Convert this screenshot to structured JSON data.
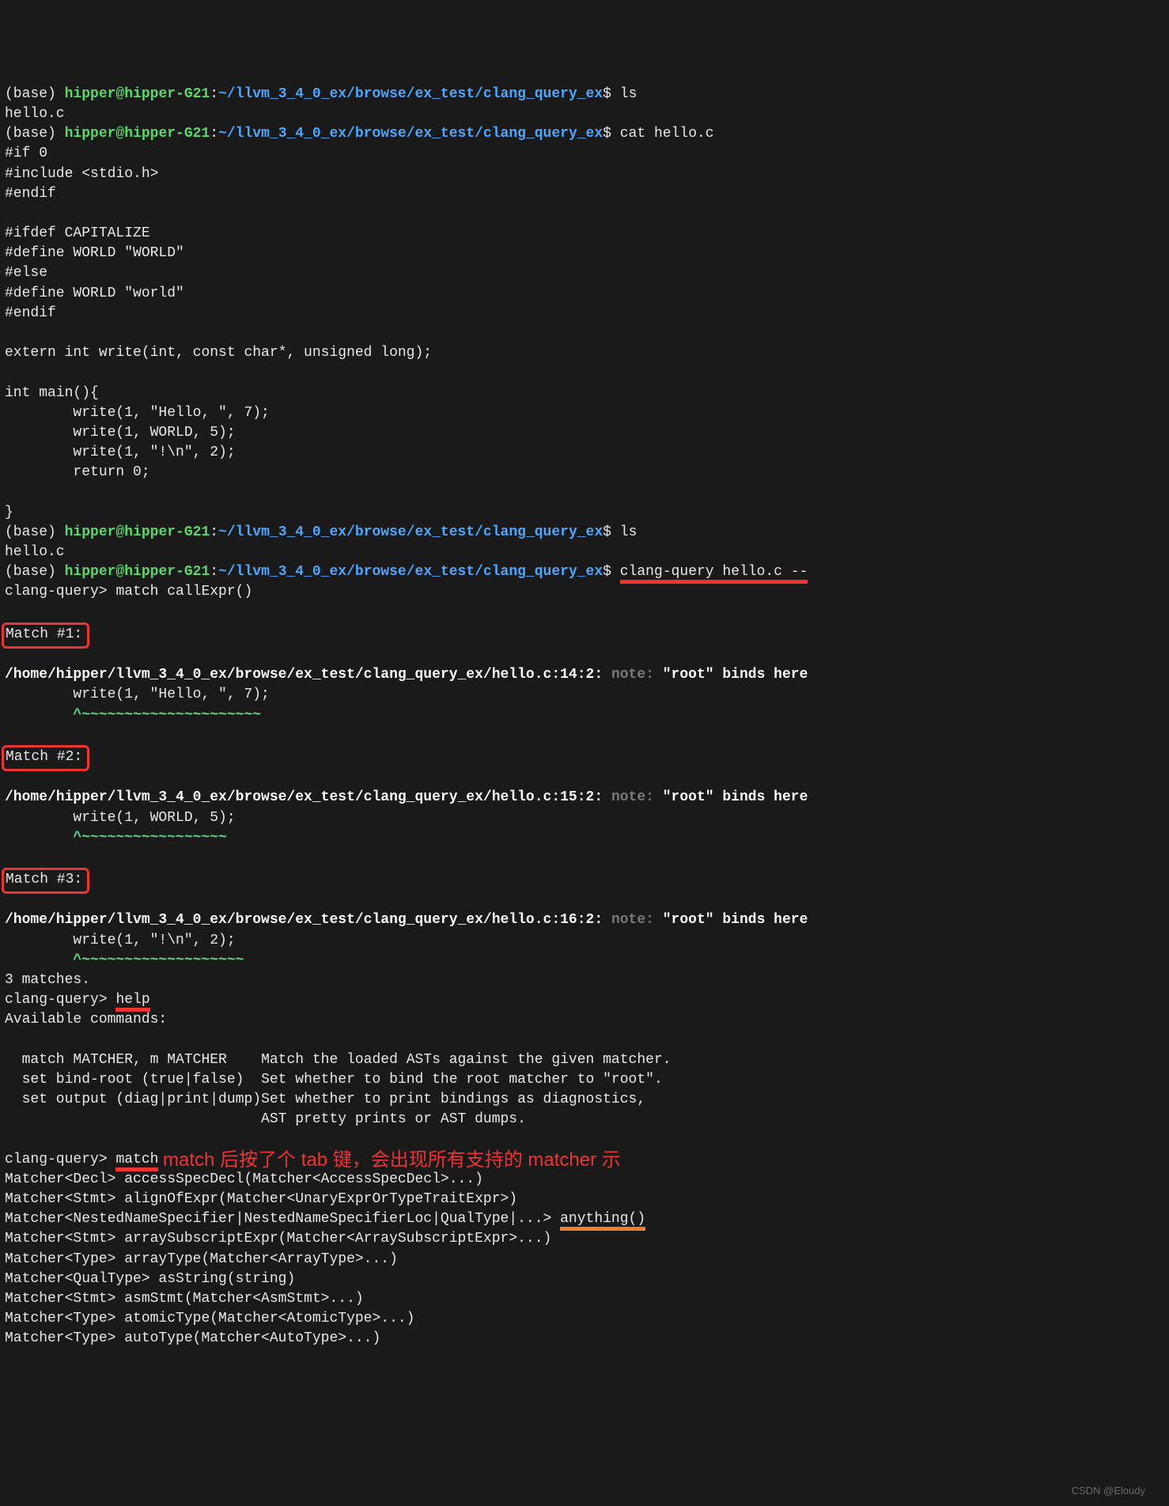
{
  "prompt": {
    "env": "(base) ",
    "userhost": "hipper@hipper-G21",
    "colon": ":",
    "cwd": "~/llvm_3_4_0_ex/browse/ex_test/clang_query_ex",
    "dollar": "$ "
  },
  "cmds": {
    "ls": "ls",
    "ls_out": "hello.c",
    "cat": "cat hello.c",
    "clang_query": "clang-query hello.c --",
    "cq_prompt": "clang-query> ",
    "match_call": "match callExpr()",
    "help": "help",
    "match": "match"
  },
  "src": {
    "l1": "#if 0",
    "l2": "#include <stdio.h>",
    "l3": "#endif",
    "l4": "",
    "l5": "#ifdef CAPITALIZE",
    "l6": "#define WORLD \"WORLD\"",
    "l7": "#else",
    "l8": "#define WORLD \"world\"",
    "l9": "#endif",
    "l10": "",
    "l11": "extern int write(int, const char*, unsigned long);",
    "l12": "",
    "l13": "int main(){",
    "l14": "        write(1, \"Hello, \", 7);",
    "l15": "        write(1, WORLD, 5);",
    "l16": "        write(1, \"!\\n\", 2);",
    "l17": "        return 0;",
    "l18": "",
    "l19": "}"
  },
  "match": {
    "m1": "Match #1:",
    "m2": "Match #2:",
    "m3": "Match #3:",
    "noteword": "note:",
    "note": " \"root\" binds here",
    "path1": "/home/hipper/llvm_3_4_0_ex/browse/ex_test/clang_query_ex/hello.c:14:2: ",
    "code1": "        write(1, \"Hello, \", 7);",
    "path2": "/home/hipper/llvm_3_4_0_ex/browse/ex_test/clang_query_ex/hello.c:15:2: ",
    "code2": "        write(1, WORLD, 5);",
    "path3": "/home/hipper/llvm_3_4_0_ex/browse/ex_test/clang_query_ex/hello.c:16:2: ",
    "code3": "        write(1, \"!\\n\", 2);",
    "tilde1": "        ^~~~~~~~~~~~~~~~~~~~~~",
    "tilde2": "        ^~~~~~~~~~~~~~~~~~",
    "tilde3": "        ^~~~~~~~~~~~~~~~~~~~",
    "count": "3 matches."
  },
  "help_out": {
    "header": "Available commands:",
    "r1a": "  match MATCHER, m MATCHER    ",
    "r1b": "Match the loaded ASTs against the given matcher.",
    "r2a": "  set bind-root (true|false)  ",
    "r2b": "Set whether to bind the root matcher to \"root\".",
    "r3a": "  set output (diag|print|dump)",
    "r3b": "Set whether to print bindings as diagnostics,",
    "r4b": "                              AST pretty prints or AST dumps."
  },
  "annotation": "match 后按了个 tab 键，会出现所有支持的 matcher 示",
  "matchers": {
    "l1": "Matcher<Decl> accessSpecDecl(Matcher<AccessSpecDecl>...)",
    "l2": "Matcher<Stmt> alignOfExpr(Matcher<UnaryExprOrTypeTraitExpr>)",
    "l3a": "Matcher<NestedNameSpecifier|NestedNameSpecifierLoc|QualType|...> ",
    "l3b": "anything()",
    "l4": "Matcher<Stmt> arraySubscriptExpr(Matcher<ArraySubscriptExpr>...)",
    "l5": "Matcher<Type> arrayType(Matcher<ArrayType>...)",
    "l6": "Matcher<QualType> asString(string)",
    "l7": "Matcher<Stmt> asmStmt(Matcher<AsmStmt>...)",
    "l8": "Matcher<Type> atomicType(Matcher<AtomicType>...)",
    "l9": "Matcher<Type> autoType(Matcher<AutoType>...)"
  },
  "watermark": "CSDN @Eloudy"
}
